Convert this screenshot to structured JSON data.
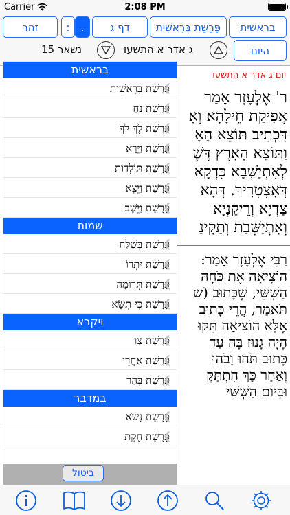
{
  "status": {
    "carrier": "Carrier",
    "time": "2:08 PM"
  },
  "toolbar": {
    "book_button": "בראשית",
    "parsha_button": "פָּרָשַׁת בְּרֵאשִׁית",
    "daf_button": "דף ג",
    "dot_button": ".",
    "colon_button": ":",
    "zohar_button": "זהר",
    "today_button": "היום",
    "date_label": "ג אדר א התשעו",
    "remaining_label": "נשאר 15"
  },
  "text": {
    "date_line": "יום ג אדר א התשעו",
    "aramaic_lines": [
      "ר' אֶלְעָזָר אָמַר",
      "אֲפִיקַת חֵילָהָא וְאִ",
      "דִּכְתִיב תּוֹצֵא הָאָ",
      "וַתּוֹצֵא הָאָרֶץ דֶּשֶׁ",
      "לְאִתְיַשְּׁבָא כִּדְקָא",
      "דְּאִצְטְרִיךְ. דְּהָא",
      "צַדְיָא וְרֵיקַנְיָא",
      "וְאִתְיַשְּׁבַת וְתַקִּינַ"
    ],
    "hebrew_lines": [
      "רַבִּי אֶלְעָזָר אָמַר:",
      "הוֹצִיאָה אֶת כֹּחָהּ",
      "הַשְּׁשִּׁי, שֶׁכָּתוּב (ש",
      "תֹּאמַר, הֲרֵי כָּתוּב",
      "אֶלָּא הוֹצִיאָה תִּקּוּ",
      "הָיָה גָנוּז בָּהּ עַד",
      "כָּתוּב תֹּהוּ וָבֹהוּ",
      "וְאַחַר כָּךְ הִתְתַּקְּ",
      "וּבְּיוֹם הַשְּׁשִּׁי"
    ]
  },
  "menu": {
    "sections": [
      {
        "title": "בראשית",
        "items": [
          "פָּרָשַׁת בְּרֵאשִׁית",
          "פָּרָשַׁת נֹחַ",
          "פָּרָשַׁת לֶךְ לְךָ",
          "פָּרָשַׁת וַיֵּרָא",
          "פָּרָשַׁת תּוֹלְדוֹת",
          "פָּרָשַׁת וַיֵּצֵא",
          "פָּרָשַׁת וַיֵּשֶׁב"
        ]
      },
      {
        "title": "שמות",
        "items": [
          "פָּרָשַׁת בְּשַׁלַּח",
          "פָּרָשַׁת יִתְרוֹ",
          "פָּרָשַׁת תְּרוּמָה",
          "פָּרָשַׁת כִּי תִשָּׂא"
        ]
      },
      {
        "title": "ויקרא",
        "items": [
          "פָּרָשַׁת צַו",
          "פָּרָשַׁת אַחֲרֵי",
          "פָּרָשַׁת בְּהַר"
        ]
      },
      {
        "title": "במדבר",
        "items": [
          "פָּרָשַׁת נָשֹׂא",
          "פָּרָשַׁת חֻקַּת"
        ]
      }
    ],
    "cancel_label": "ביטול"
  },
  "tabbar": {
    "icons": [
      "info-icon",
      "book-icon",
      "arrow-down-circle-icon",
      "arrow-up-circle-icon",
      "search-icon",
      "gear-icon"
    ]
  },
  "colors": {
    "accent": "#0b63ff",
    "date_red": "#d6201a"
  }
}
